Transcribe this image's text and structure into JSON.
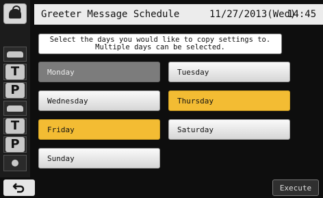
{
  "header": {
    "title": "Greeter Message Schedule",
    "date": "11/27/2013(Wed)",
    "time": "14:45"
  },
  "instruction": {
    "line1": "Select the days you would like to copy settings to.",
    "line2": "Multiple days can be selected."
  },
  "days": [
    {
      "label": "Monday",
      "state": "disabled"
    },
    {
      "label": "Tuesday",
      "state": "normal"
    },
    {
      "label": "Wednesday",
      "state": "normal"
    },
    {
      "label": "Thursday",
      "state": "selected"
    },
    {
      "label": "Friday",
      "state": "selected"
    },
    {
      "label": "Saturday",
      "state": "normal"
    },
    {
      "label": "Sunday",
      "state": "normal"
    }
  ],
  "rail": {
    "letters": [
      "T",
      "P",
      "T",
      "P"
    ],
    "icons": [
      "lock-icon",
      "car-icon",
      "car-icon",
      "dot-icon"
    ]
  },
  "footer": {
    "back_icon": "back-arrow-icon",
    "execute_label": "Execute"
  },
  "colors": {
    "selected": "#f3bc33",
    "disabled": "#7c7c7c",
    "background": "#0e0e0e"
  }
}
